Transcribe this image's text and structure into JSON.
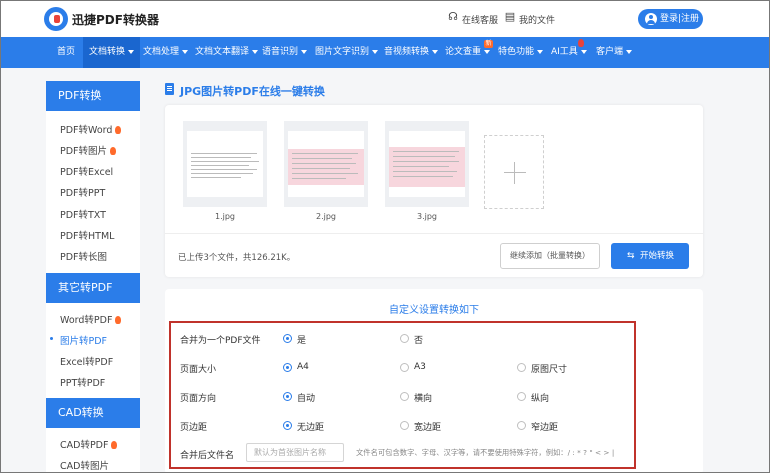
{
  "header": {
    "brand": "迅捷PDF转换器",
    "service": "在线客服",
    "my_files": "我的文件",
    "login": "登录|注册"
  },
  "nav": {
    "items": [
      {
        "label": "首页"
      },
      {
        "label": "文档转换"
      },
      {
        "label": "文档处理"
      },
      {
        "label": "文档文本翻译"
      },
      {
        "label": "语音识别"
      },
      {
        "label": "图片文字识别"
      },
      {
        "label": "音视频转换"
      },
      {
        "label": "论文查重"
      },
      {
        "label": "特色功能"
      },
      {
        "label": "AI工具"
      },
      {
        "label": "客户端"
      }
    ],
    "badge": "新"
  },
  "sidebar": {
    "groups": [
      {
        "title": "PDF转换",
        "items": [
          "PDF转Word",
          "PDF转图片",
          "PDF转Excel",
          "PDF转PPT",
          "PDF转TXT",
          "PDF转HTML",
          "PDF转长图"
        ]
      },
      {
        "title": "其它转PDF",
        "items": [
          "Word转PDF",
          "图片转PDF",
          "Excel转PDF",
          "PPT转PDF"
        ]
      },
      {
        "title": "CAD转换",
        "items": [
          "CAD转PDF",
          "CAD转图片"
        ]
      }
    ]
  },
  "main": {
    "title": "JPG图片转PDF在线一键转换",
    "files": [
      {
        "name": "1.jpg"
      },
      {
        "name": "2.jpg"
      },
      {
        "name": "3.jpg"
      }
    ],
    "status": "已上传3个文件，共126.21K。",
    "continue_label": "继续添加（批量转换）",
    "start_label": "开始转换"
  },
  "settings": {
    "title": "自定义设置转换如下",
    "rows": [
      {
        "label": "合并为一个PDF文件",
        "options": [
          "是",
          "否"
        ],
        "selected": 0
      },
      {
        "label": "页面大小",
        "options": [
          "A4",
          "A3",
          "原图尺寸"
        ],
        "selected": 0
      },
      {
        "label": "页面方向",
        "options": [
          "自动",
          "横向",
          "纵向"
        ],
        "selected": 0
      },
      {
        "label": "页边距",
        "options": [
          "无边距",
          "宽边距",
          "窄边距"
        ],
        "selected": 0
      }
    ],
    "filename_label": "合并后文件名",
    "filename_placeholder": "默认为首张图片名称",
    "filename_hint": "文件名可包含数字、字母、汉字等，请不要使用特殊字符，例如：/ : * ? \" < > |"
  }
}
